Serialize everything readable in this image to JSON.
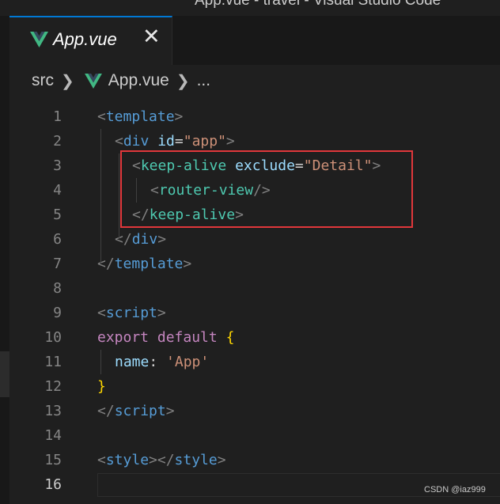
{
  "window": {
    "title": "App.vue - travel - Visual Studio Code"
  },
  "tab": {
    "label": "App.vue",
    "icon": "vue-icon",
    "close": "✕"
  },
  "breadcrumb": {
    "folder": "src",
    "file": "App.vue",
    "more": "..."
  },
  "editor": {
    "active_line": 16,
    "lines": [
      {
        "num": "1",
        "tokens": [
          [
            "punct",
            "<"
          ],
          [
            "tag",
            "template"
          ],
          [
            "punct",
            ">"
          ]
        ]
      },
      {
        "num": "2",
        "tokens": [
          [
            "punct",
            "<"
          ],
          [
            "tag",
            "div"
          ],
          [
            "op",
            " "
          ],
          [
            "attr",
            "id"
          ],
          [
            "op",
            "="
          ],
          [
            "str",
            "\"app\""
          ],
          [
            "punct",
            ">"
          ]
        ]
      },
      {
        "num": "3",
        "tokens": [
          [
            "punct",
            "<"
          ],
          [
            "ctag",
            "keep-alive"
          ],
          [
            "op",
            " "
          ],
          [
            "attr",
            "exclude"
          ],
          [
            "op",
            "="
          ],
          [
            "str",
            "\"Detail\""
          ],
          [
            "punct",
            ">"
          ]
        ]
      },
      {
        "num": "4",
        "tokens": [
          [
            "punct",
            "<"
          ],
          [
            "ctag",
            "router-view"
          ],
          [
            "punct",
            "/>"
          ]
        ]
      },
      {
        "num": "5",
        "tokens": [
          [
            "punct",
            "</"
          ],
          [
            "ctag",
            "keep-alive"
          ],
          [
            "punct",
            ">"
          ]
        ]
      },
      {
        "num": "6",
        "tokens": [
          [
            "punct",
            "</"
          ],
          [
            "tag",
            "div"
          ],
          [
            "punct",
            ">"
          ]
        ]
      },
      {
        "num": "7",
        "tokens": [
          [
            "punct",
            "</"
          ],
          [
            "tag",
            "template"
          ],
          [
            "punct",
            ">"
          ]
        ]
      },
      {
        "num": "8",
        "tokens": []
      },
      {
        "num": "9",
        "tokens": [
          [
            "punct",
            "<"
          ],
          [
            "tag",
            "script"
          ],
          [
            "punct",
            ">"
          ]
        ]
      },
      {
        "num": "10",
        "tokens": [
          [
            "kw",
            "export"
          ],
          [
            "op",
            " "
          ],
          [
            "kw",
            "default"
          ],
          [
            "op",
            " "
          ],
          [
            "brace",
            "{"
          ]
        ]
      },
      {
        "num": "11",
        "tokens": [
          [
            "attr",
            "name"
          ],
          [
            "op",
            ": "
          ],
          [
            "str",
            "'App'"
          ]
        ]
      },
      {
        "num": "12",
        "tokens": [
          [
            "brace",
            "}"
          ]
        ]
      },
      {
        "num": "13",
        "tokens": [
          [
            "punct",
            "</"
          ],
          [
            "tag",
            "script"
          ],
          [
            "punct",
            ">"
          ]
        ]
      },
      {
        "num": "14",
        "tokens": []
      },
      {
        "num": "15",
        "tokens": [
          [
            "punct",
            "<"
          ],
          [
            "tag",
            "style"
          ],
          [
            "punct",
            "></"
          ],
          [
            "tag",
            "style"
          ],
          [
            "punct",
            ">"
          ]
        ]
      },
      {
        "num": "16",
        "tokens": []
      }
    ]
  },
  "colors": {
    "editor_bg": "#1f1f1f",
    "tag": "#569cd6",
    "component_tag": "#4ec9b0",
    "attribute": "#9cdcfe",
    "string": "#ce9178",
    "keyword": "#c586c0",
    "highlight_box": "#e0373b",
    "tab_accent": "#0078d4"
  },
  "watermark": "CSDN @iaz999"
}
